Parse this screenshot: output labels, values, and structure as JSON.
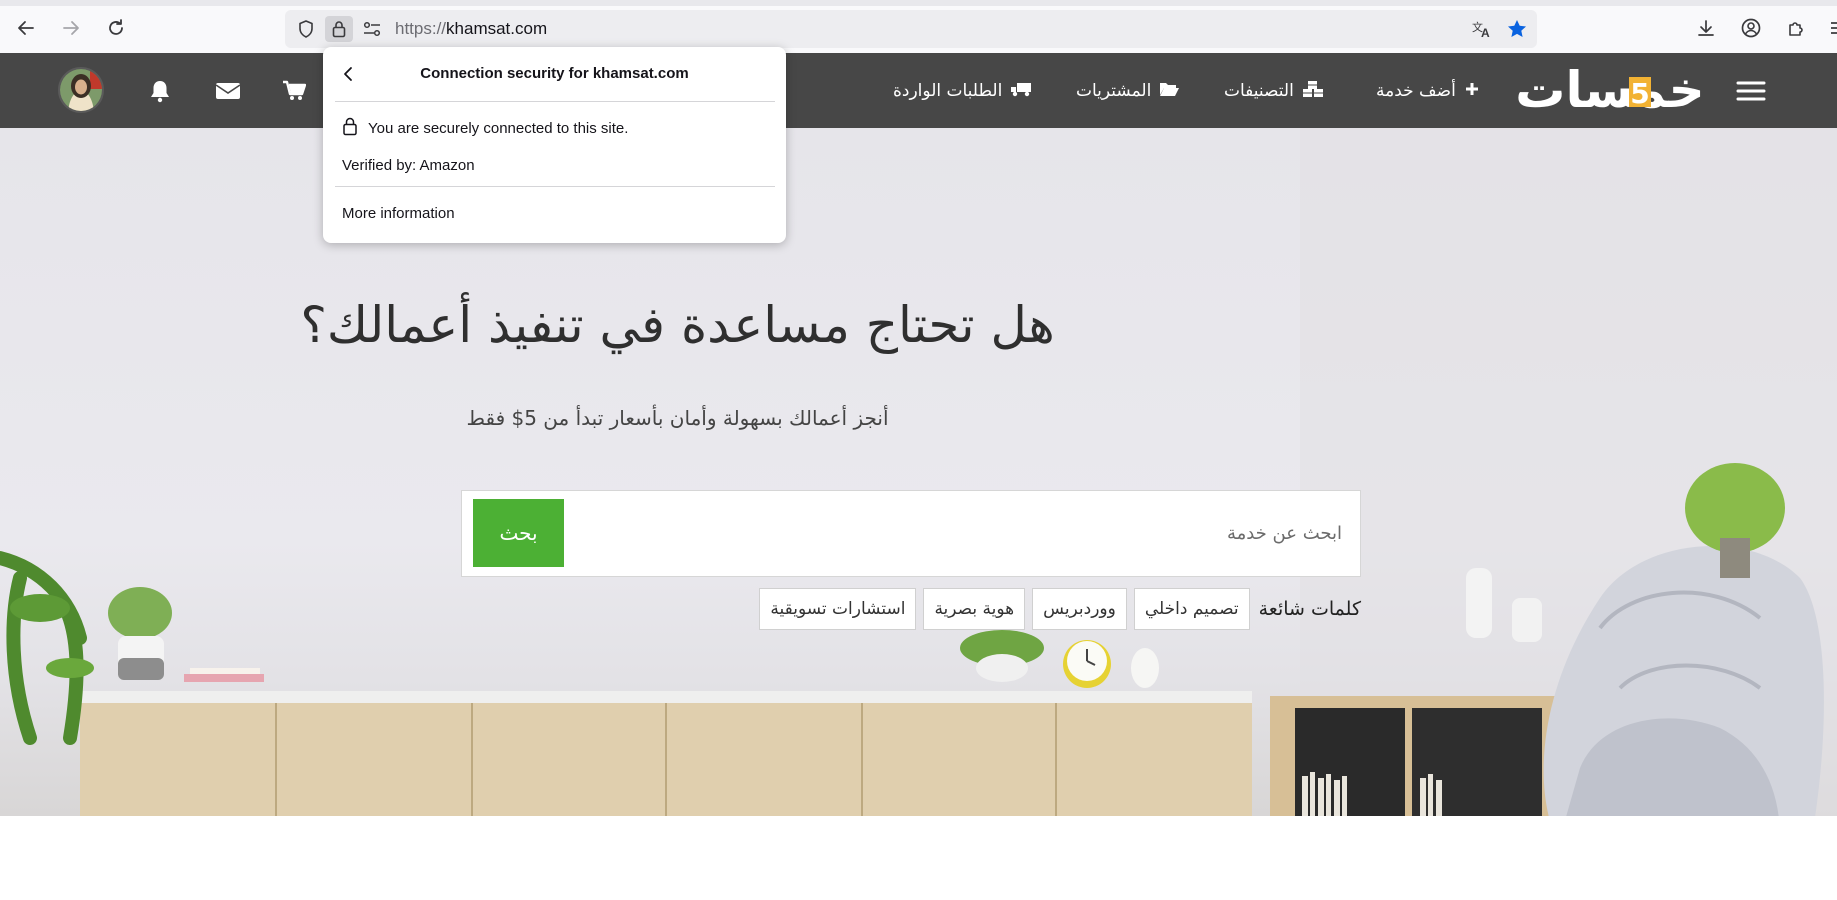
{
  "browser": {
    "url_scheme": "https://",
    "url_host": "khamsat.com",
    "icons": [
      "back-arrow-icon",
      "forward-arrow-icon",
      "reload-icon",
      "shield-icon",
      "lock-icon",
      "permissions-icon",
      "translate-icon",
      "star-icon",
      "download-icon",
      "account-icon",
      "extensions-icon"
    ]
  },
  "popup": {
    "title": "Connection security for khamsat.com",
    "secure_text": "You are securely connected to this site.",
    "verified_text": "Verified by: Amazon",
    "more_info": "More information"
  },
  "header": {
    "nav": {
      "add_service": "أضف خدمة",
      "categories": "التصنيفات",
      "purchases": "المشتريات",
      "incoming": "الطلبات الواردة"
    },
    "icons": [
      "menu-icon",
      "plus-icon",
      "cubes-icon",
      "folder-open-icon",
      "truck-icon",
      "cart-icon",
      "envelope-icon",
      "bell-icon"
    ],
    "brand_color": "#474747"
  },
  "hero": {
    "title": "هل تحتاج مساعدة في تنفيذ أعمالك؟",
    "subtitle": "أنجز أعمالك بسهولة وأمان بأسعار تبدأ من 5$ فقط",
    "search_placeholder": "ابحث عن خدمة",
    "search_button": "بحث",
    "popular_label": "كلمات شائعة",
    "tags": [
      "تصميم داخلي",
      "ووردبريس",
      "هوية بصرية",
      "استشارات تسويقية"
    ],
    "accent_color": "#4cb034"
  }
}
